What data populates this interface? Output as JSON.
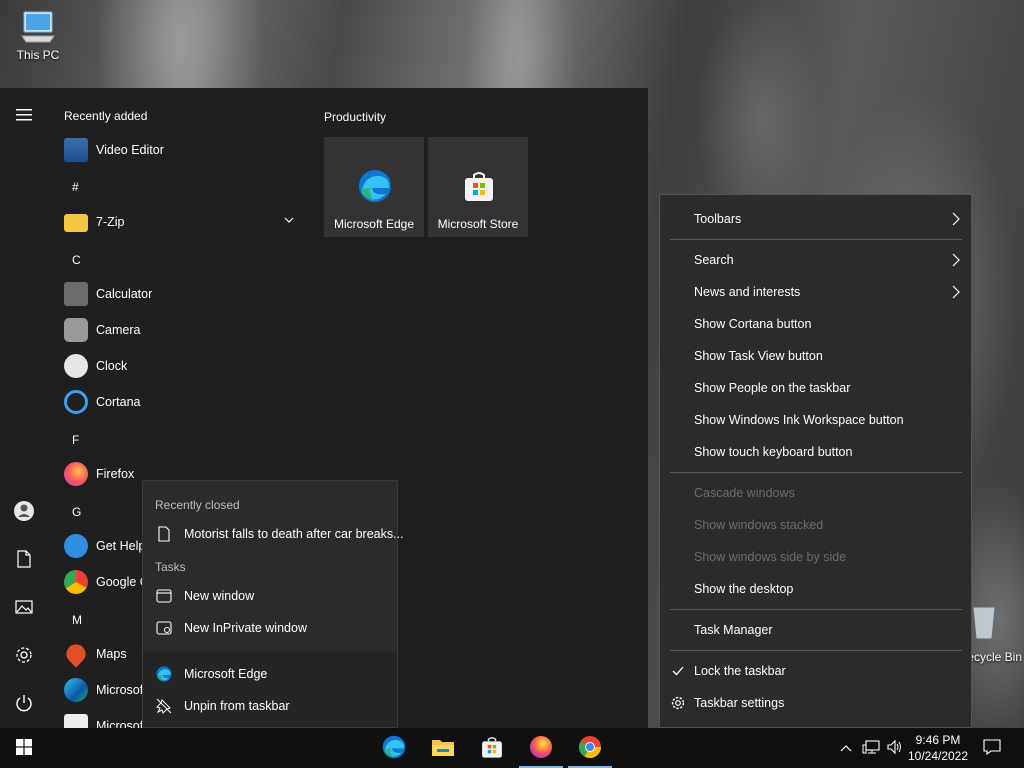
{
  "desktop": {
    "icons": [
      {
        "label": "This PC",
        "icon": "this-pc-icon"
      },
      {
        "label": "Recycle Bin",
        "icon": "recycle-bin-icon"
      }
    ]
  },
  "start_menu": {
    "rail": [
      {
        "name": "expand",
        "icon": "hamburger-icon"
      },
      {
        "name": "account",
        "icon": "user-icon"
      },
      {
        "name": "documents",
        "icon": "document-icon"
      },
      {
        "name": "pictures",
        "icon": "pictures-icon"
      },
      {
        "name": "settings",
        "icon": "gear-icon"
      },
      {
        "name": "power",
        "icon": "power-icon"
      }
    ],
    "recently_added_title": "Recently added",
    "apps": {
      "video_editor": "Video Editor",
      "letter_hash": "#",
      "seven_zip": "7-Zip",
      "letter_c": "C",
      "calculator": "Calculator",
      "camera": "Camera",
      "clock": "Clock",
      "cortana": "Cortana",
      "letter_f": "F",
      "firefox": "Firefox",
      "letter_g": "G",
      "get_help": "Get Help",
      "google_chrome": "Google C",
      "letter_m": "M",
      "maps": "Maps",
      "microsoft_edge": "Microsof",
      "microsoft_store": "Microsof"
    },
    "tiles_group_title": "Productivity",
    "tiles": {
      "edge": "Microsoft Edge",
      "store": "Microsoft Store"
    }
  },
  "jumplist": {
    "recently_closed_title": "Recently closed",
    "recent_item": "Motorist falls to death after car breaks...",
    "tasks_title": "Tasks",
    "new_window": "New window",
    "new_inprivate": "New InPrivate window",
    "app_name": "Microsoft Edge",
    "unpin": "Unpin from taskbar"
  },
  "context_menu": {
    "toolbars": "Toolbars",
    "search": "Search",
    "news": "News and interests",
    "cortana": "Show Cortana button",
    "task_view": "Show Task View button",
    "people": "Show People on the taskbar",
    "ink": "Show Windows Ink Workspace button",
    "touch_keyboard": "Show touch keyboard button",
    "cascade": "Cascade windows",
    "stacked": "Show windows stacked",
    "side_by_side": "Show windows side by side",
    "show_desktop": "Show the desktop",
    "task_manager": "Task Manager",
    "lock": "Lock the taskbar",
    "lock_checked": true,
    "settings": "Taskbar settings"
  },
  "taskbar": {
    "pinned": [
      {
        "name": "Microsoft Edge",
        "icon": "edge-icon",
        "active": false
      },
      {
        "name": "File Explorer",
        "icon": "folder-icon",
        "active": false
      },
      {
        "name": "Microsoft Store",
        "icon": "store-icon",
        "active": false
      },
      {
        "name": "Firefox",
        "icon": "firefox-icon",
        "active": true
      },
      {
        "name": "Google Chrome",
        "icon": "chrome-icon",
        "active": true
      }
    ],
    "time": "9:46 PM",
    "date": "10/24/2022"
  },
  "colors": {
    "start_bg": "#1f1f1f",
    "menu_bg": "#2b2b2b",
    "taskbar_bg": "#101010",
    "accent_underline": "#76b9ed",
    "disabled_text": "#6d6d6d"
  }
}
